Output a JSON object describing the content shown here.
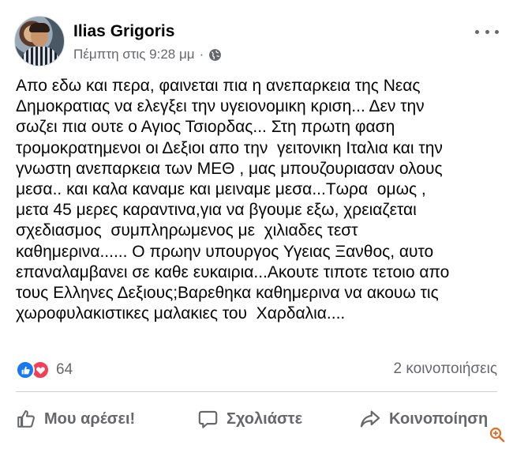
{
  "post": {
    "author_name": "Ilias Grigoris",
    "timestamp": "Πέμπτη στις 9:28 μμ",
    "separator": "·",
    "privacy_icon": "globe-icon",
    "more_icon": "more-options-icon",
    "text": "Απο εδω και περα, φαινεται πια η ανεπαρκεια της Νεας\nΔημοκρατιας να ελεγξει την υγειονομικη κριση... Δεν την\nσωζει πια ουτε ο Αγιος Τσιορδας... Στη πρωτη φαση\nτρομοκρατημενοι οι Δεξιοι απο την  γειτονικη Ιταλια και την\nγνωστη ανεπαρκεια των ΜΕΘ , μας μπουζουριασαν ολους\nμεσα.. και καλα καναμε και μειναμε μεσα...Τωρα  ομως ,\nμετα 45 μερες καραντινα,για να βγουμε εξω, χρειαζεται\nσχεδιασμος  συμπληρωμενος με  χιλιαδες τεστ\nκαθημερινα...... Ο πρωην υπουργος Υγειας Ξανθος, αυτο\nεπαναλαμβανει σε καθε ευκαιρια...Ακουτε τιποτε τετοιο απο\nτους Ελληνες Δεξιους;Βαρεθηκα καθημερινα να ακουω τις\nχωροφυλακιστικες μαλακιες του  Χαρδαλια...."
  },
  "engagement": {
    "reaction_count": "64",
    "shares_text": "2 κοινοποιήσεις"
  },
  "actions": {
    "like_label": "Μου αρέσει!",
    "comment_label": "Σχολιάστε",
    "share_label": "Κοινοποίηση"
  },
  "colors": {
    "like_blue": "#1877f2",
    "love_red": "#f33e58",
    "secondary_text": "#65676b",
    "zoom_orange": "#e0702a"
  }
}
